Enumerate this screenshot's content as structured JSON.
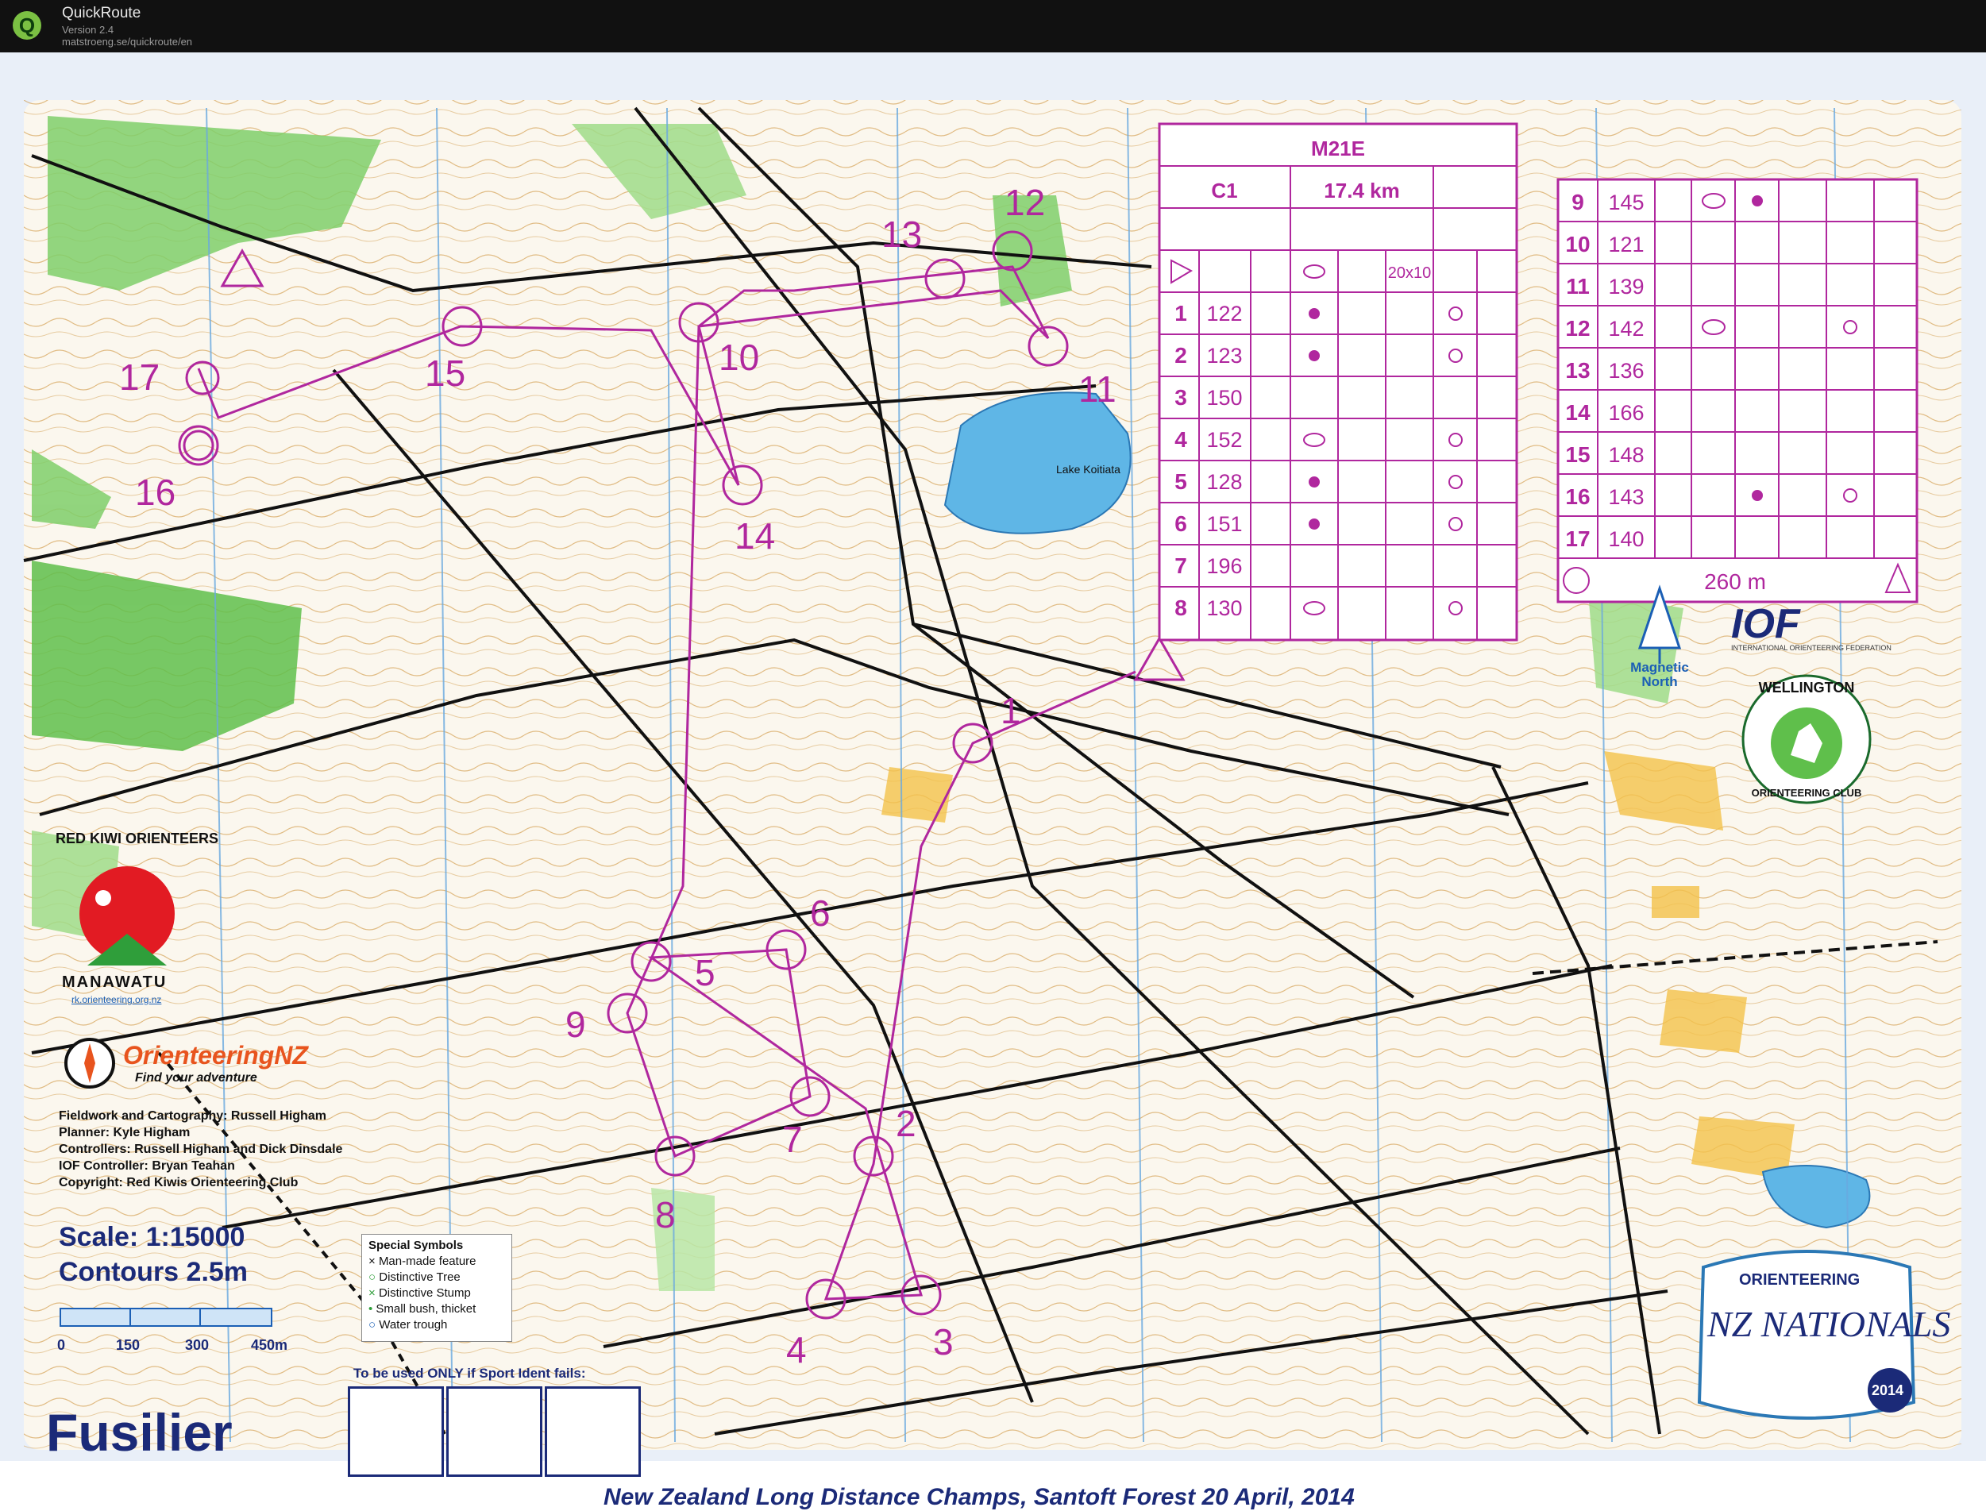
{
  "app": {
    "name": "QuickRoute",
    "version": "Version 2.4",
    "url": "matstroeng.se/quickroute/en"
  },
  "map": {
    "area_name": "Fusilier",
    "lake_label": "Lake Koitiata",
    "footer": "New Zealand Long Distance Champs, Santoft Forest    20 April, 2014",
    "credits": [
      "Fieldwork and Cartography: Russell Higham",
      "Planner: Kyle Higham",
      "Controllers: Russell Higham and Dick Dinsdale",
      "IOF Controller: Bryan Teahan",
      "Copyright: Red Kiwis Orienteering Club"
    ],
    "scale_text": "Scale: 1:15000",
    "contours_text": "Contours  2.5m",
    "scale_bar_labels": [
      "0",
      "150",
      "300",
      "450m"
    ],
    "special_symbols": {
      "title": "Special Symbols",
      "items": [
        "Man-made feature",
        "Distinctive Tree",
        "Distinctive Stump",
        "Small bush, thicket",
        "Water trough"
      ]
    },
    "backup_boxes_label": "To be used ONLY if Sport Ident fails:",
    "north_label_1": "Magnetic",
    "north_label_2": "North",
    "logos": {
      "red_kiwi": "RED KIWI ORIENTEERS",
      "red_kiwi_region": "MANAWATU",
      "red_kiwi_url": "rk.orienteering.org.nz",
      "onz": "OrienteeringNZ",
      "onz_tagline": "Find your adventure",
      "iof": "IOF",
      "iof_full": "INTERNATIONAL ORIENTEERING FEDERATION",
      "wellington_1": "WELLINGTON",
      "wellington_2": "ORIENTEERING CLUB",
      "nationals_1": "ORIENTEERING",
      "nationals_2": "NZ NATIONALS",
      "nationals_year": "2014"
    },
    "course_color": "#b0279e",
    "control_labels": [
      "1",
      "2",
      "3",
      "4",
      "5",
      "6",
      "7",
      "8",
      "9",
      "10",
      "11",
      "12",
      "13",
      "14",
      "15",
      "16",
      "17"
    ]
  },
  "descriptions": {
    "course": "M21E",
    "class": "C1",
    "length": "17.4 km",
    "start_size": "20x10",
    "finish_length": "260 m",
    "left_rows": [
      {
        "n": "1",
        "code": "122"
      },
      {
        "n": "2",
        "code": "123"
      },
      {
        "n": "3",
        "code": "150"
      },
      {
        "n": "4",
        "code": "152"
      },
      {
        "n": "5",
        "code": "128"
      },
      {
        "n": "6",
        "code": "151"
      },
      {
        "n": "7",
        "code": "196"
      },
      {
        "n": "8",
        "code": "130"
      }
    ],
    "right_rows": [
      {
        "n": "9",
        "code": "145"
      },
      {
        "n": "10",
        "code": "121"
      },
      {
        "n": "11",
        "code": "139"
      },
      {
        "n": "12",
        "code": "142"
      },
      {
        "n": "13",
        "code": "136"
      },
      {
        "n": "14",
        "code": "166"
      },
      {
        "n": "15",
        "code": "148"
      },
      {
        "n": "16",
        "code": "143"
      },
      {
        "n": "17",
        "code": "140"
      }
    ]
  }
}
